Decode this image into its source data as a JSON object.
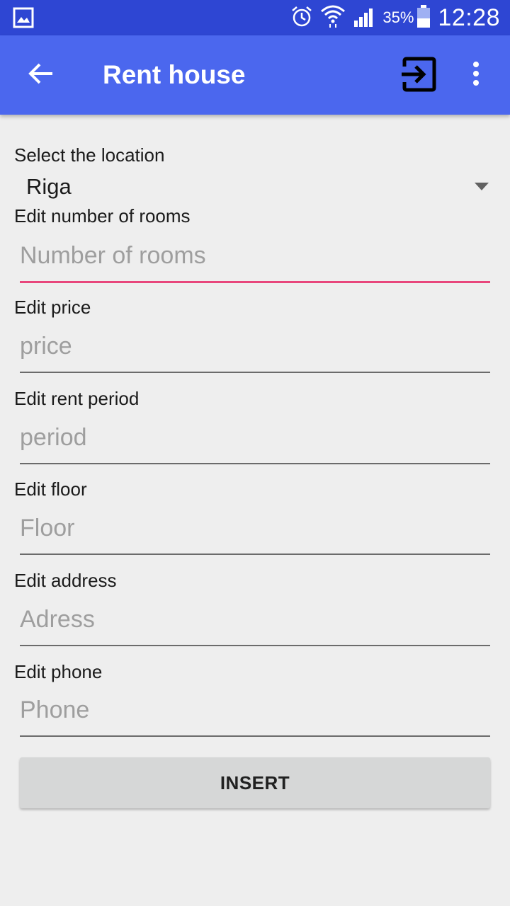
{
  "status_bar": {
    "battery_percent": "35%",
    "time": "12:28",
    "icons": [
      "gallery-notification-icon",
      "alarm-icon",
      "wifi-icon",
      "cell-signal-icon",
      "battery-icon"
    ]
  },
  "app_bar": {
    "title": "Rent house",
    "actions": [
      "back-arrow-icon",
      "exit-icon",
      "more-vert-icon"
    ]
  },
  "form": {
    "location_label": "Select the location",
    "location_value": "Riga",
    "rooms_label": "Edit number of rooms",
    "rooms_placeholder": "Number of rooms",
    "price_label": "Edit price",
    "price_placeholder": "price",
    "period_label": "Edit rent period",
    "period_placeholder": "period",
    "floor_label": "Edit floor",
    "floor_placeholder": "Floor",
    "address_label": "Edit address",
    "address_placeholder": "Adress",
    "phone_label": "Edit phone",
    "phone_placeholder": "Phone",
    "insert_label": "INSERT"
  },
  "colors": {
    "status_bar": "#2e46d3",
    "app_bar": "#4b67ee",
    "focus_accent": "#e8467c",
    "background": "#eeeeee",
    "button": "#d6d7d7"
  }
}
